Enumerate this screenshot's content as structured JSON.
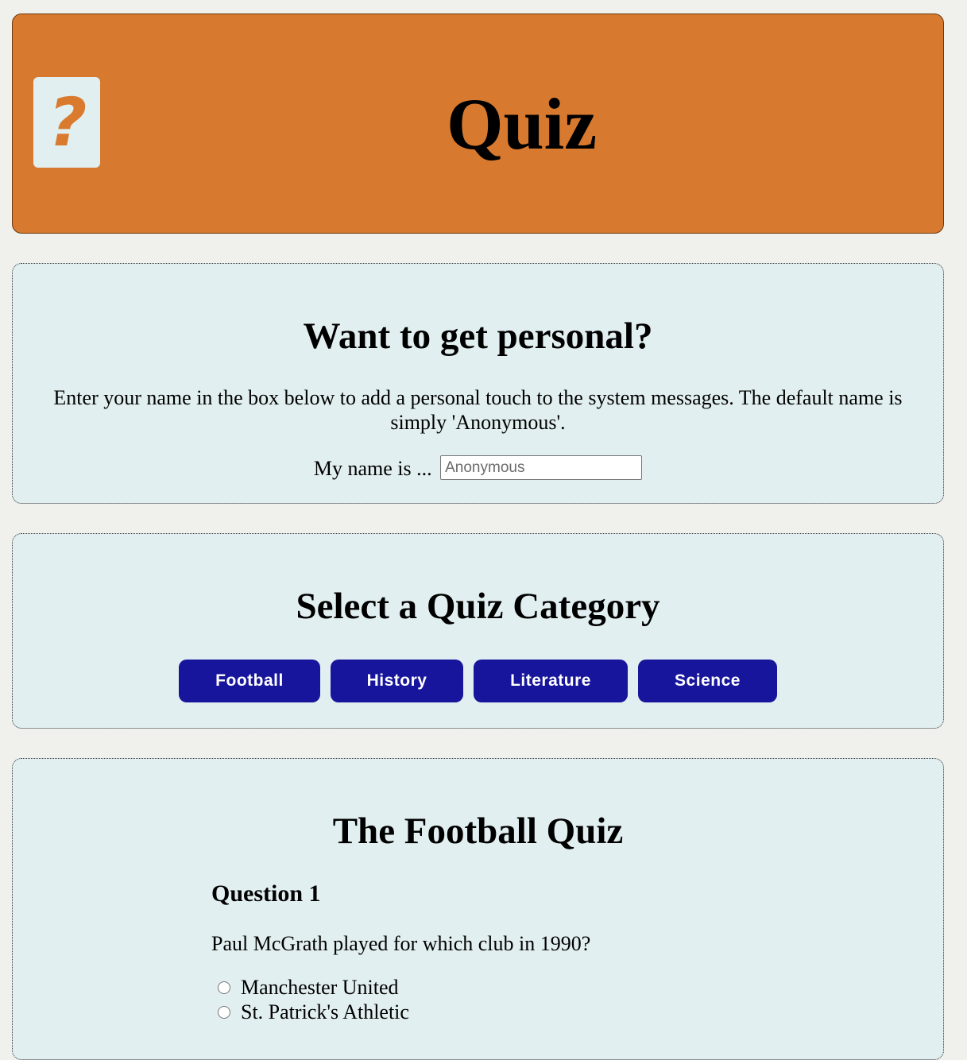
{
  "header": {
    "title": "Quiz",
    "logo_icon": "question-mark-icon",
    "logo_glyph": "?",
    "background_color": "#d7792e"
  },
  "personal": {
    "heading": "Want to get personal?",
    "intro": "Enter your name in the box below to add a personal touch to the system messages. The default name is simply 'Anonymous'.",
    "name_label": "My name is ...",
    "name_value": "",
    "name_placeholder": "Anonymous"
  },
  "categories": {
    "heading": "Select a Quiz Category",
    "button_color": "#17159c",
    "items": [
      {
        "label": "Football"
      },
      {
        "label": "History"
      },
      {
        "label": "Literature"
      },
      {
        "label": "Science"
      }
    ]
  },
  "quiz": {
    "heading": "The Football Quiz",
    "question": {
      "number_label": "Question 1",
      "text": "Paul McGrath played for which club in 1990?",
      "options": [
        {
          "label": "Manchester United",
          "checked": false
        },
        {
          "label": "St. Patrick's Athletic",
          "checked": false
        }
      ]
    }
  }
}
